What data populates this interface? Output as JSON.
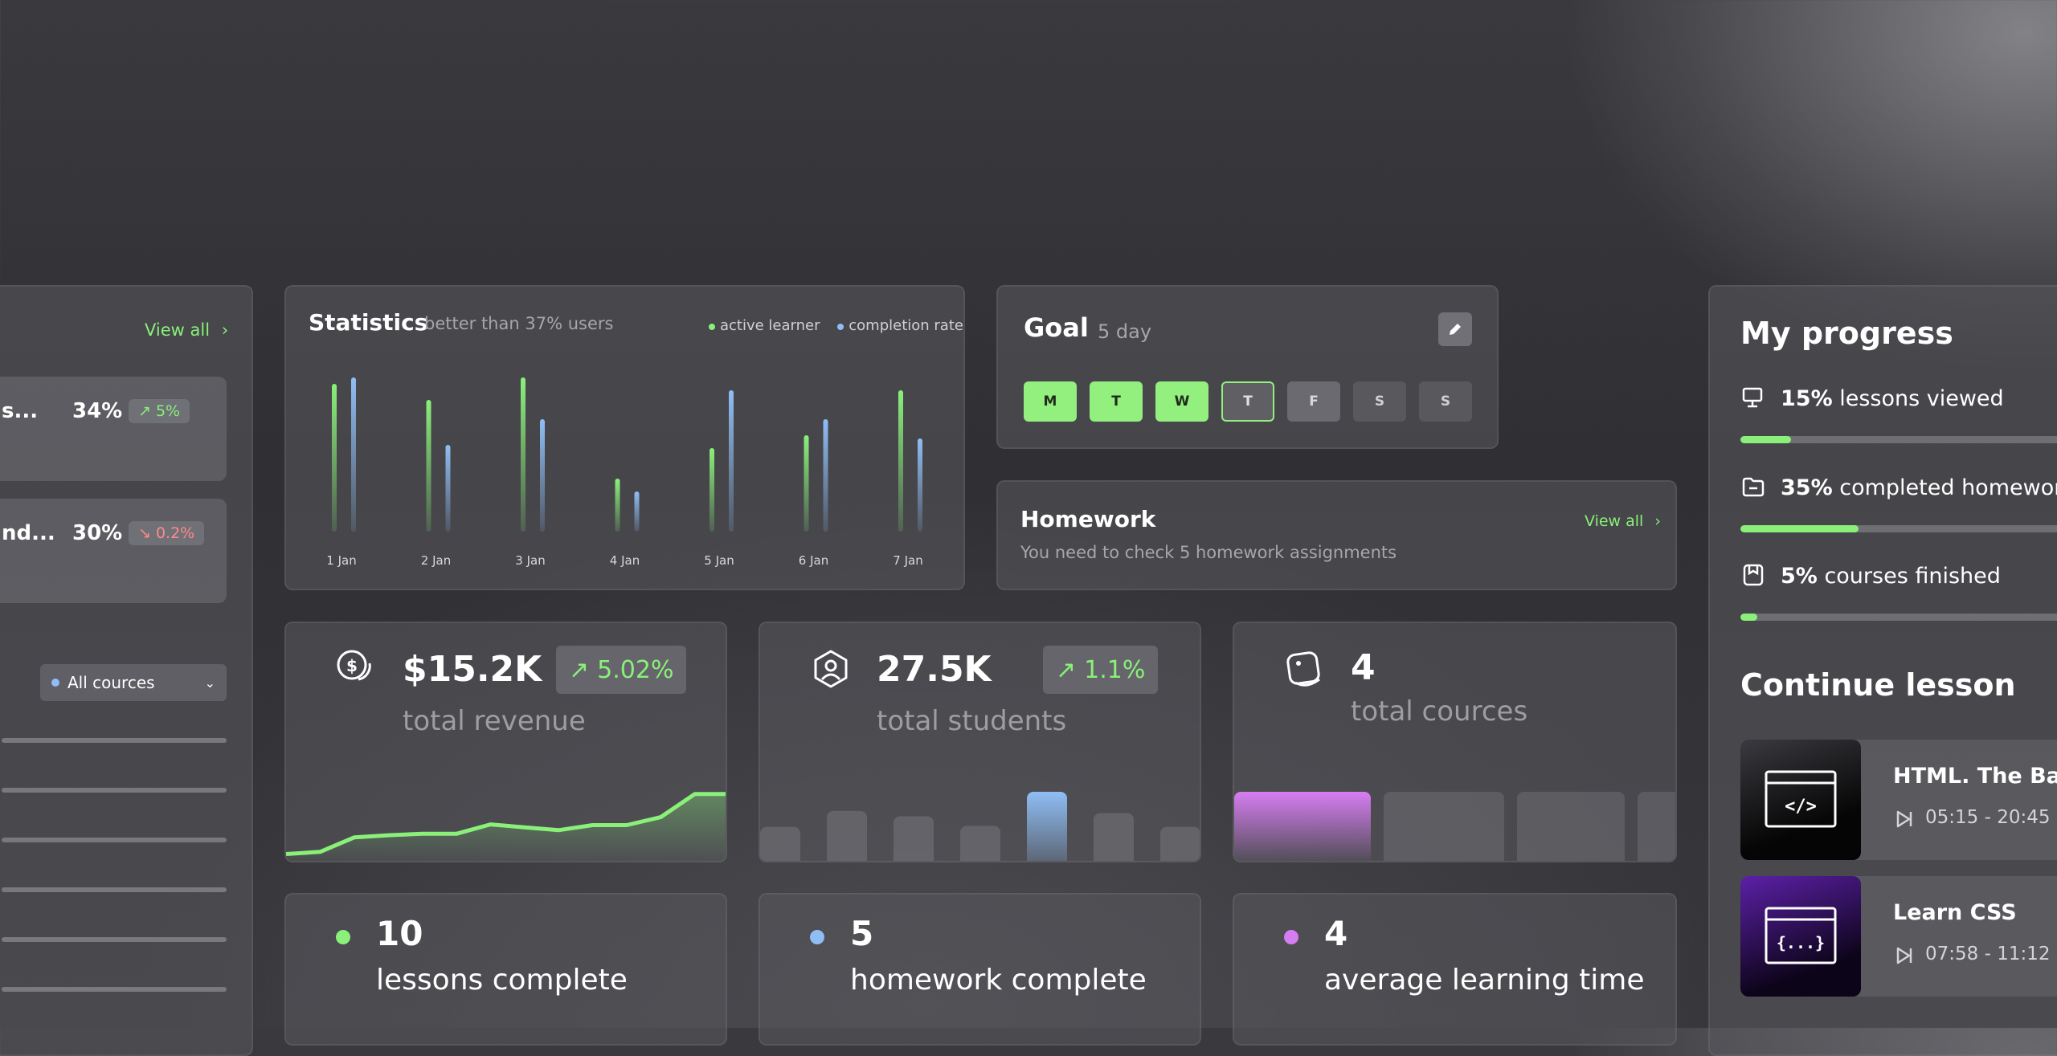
{
  "left_panel": {
    "view_all": "View all",
    "rows": [
      {
        "name": "s...",
        "percent": "34%",
        "change": "5%",
        "direction": "up"
      },
      {
        "name": "nd...",
        "percent": "30%",
        "change": "0.2%",
        "direction": "down"
      }
    ],
    "filter": "All cources"
  },
  "statistics": {
    "title": "Statistics",
    "subtitle": "better than 37% users",
    "legend": [
      {
        "label": "active learner",
        "color": "#8af07a"
      },
      {
        "label": "completion rate",
        "color": "#8fbef5"
      }
    ]
  },
  "chart_data": {
    "type": "bar",
    "categories": [
      "1 Jan",
      "2 Jan",
      "3 Jan",
      "4 Jan",
      "5 Jan",
      "6 Jan",
      "7 Jan"
    ],
    "series": [
      {
        "name": "active learner",
        "values": [
          92,
          82,
          96,
          33,
          52,
          60,
          88
        ]
      },
      {
        "name": "completion rate",
        "values": [
          96,
          54,
          70,
          25,
          88,
          70,
          58
        ]
      }
    ],
    "ylim": [
      0,
      100
    ]
  },
  "goal": {
    "title": "Goal",
    "subtitle": "5 day",
    "days": [
      {
        "label": "M",
        "state": "done"
      },
      {
        "label": "T",
        "state": "done"
      },
      {
        "label": "W",
        "state": "done"
      },
      {
        "label": "T",
        "state": "today"
      },
      {
        "label": "F",
        "state": "rest"
      },
      {
        "label": "S",
        "state": "future"
      },
      {
        "label": "S",
        "state": "future"
      }
    ]
  },
  "homework": {
    "title": "Homework",
    "subtitle": "You need to check 5 homework assignments",
    "view_all": "View all"
  },
  "kpis": {
    "revenue": {
      "value": "$15.2K",
      "label": "total revenue",
      "change": "5.02%",
      "trend": [
        5,
        8,
        28,
        31,
        33,
        33,
        46,
        42,
        38,
        45,
        45,
        56,
        88,
        88
      ]
    },
    "students": {
      "value": "27.5K",
      "label": "total students",
      "change": "1.1%",
      "bars": [
        35,
        50,
        45,
        36,
        68,
        48,
        35
      ]
    },
    "courses": {
      "value": "4",
      "label": "total cources"
    }
  },
  "summary": [
    {
      "value": "10",
      "label": "lessons complete",
      "color": "#8af07a"
    },
    {
      "value": "5",
      "label": "homework complete",
      "color": "#8fbef5"
    },
    {
      "value": "4",
      "label": "average learning time",
      "color": "#d77df2"
    }
  ],
  "my_progress": {
    "title": "My progress",
    "items": [
      {
        "percent": "15%",
        "label": "lessons viewed",
        "value": 15,
        "icon": "monitor-icon"
      },
      {
        "percent": "35%",
        "label": "completed homework",
        "value": 35,
        "icon": "folder-icon"
      },
      {
        "percent": "5%",
        "label": "courses finished",
        "value": 5,
        "icon": "bookmark-icon"
      }
    ]
  },
  "continue_lesson": {
    "title": "Continue lesson",
    "lessons": [
      {
        "title": "HTML. The Basi",
        "time": "05:15 - 20:45",
        "thumb_icon": "</>",
        "accent": "#2a2a2e"
      },
      {
        "title": "Learn CSS",
        "time": "07:58 - 11:12",
        "thumb_icon": "{...}",
        "accent": "#4c1a8c"
      }
    ]
  }
}
